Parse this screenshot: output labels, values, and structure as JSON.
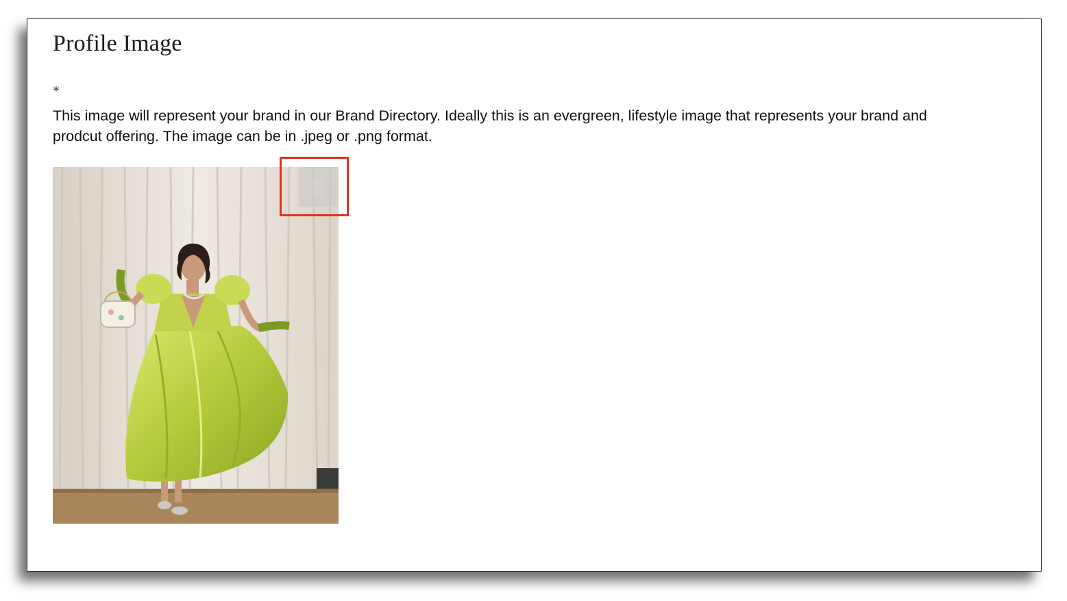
{
  "section": {
    "title": "Profile Image",
    "required_marker": "*",
    "description": "This image will represent your brand in our Brand Directory. Ideally this is an evergreen, lifestyle image that represents your brand and prodcut offering. The image can be in .jpeg or .png format."
  },
  "uploaded_image": {
    "subject": "photo-woman-green-dress",
    "delete_icon": "trash-icon"
  },
  "colors": {
    "highlight": "#e0301e",
    "dress": "#b5c93f",
    "curtain": "#ece6df"
  }
}
